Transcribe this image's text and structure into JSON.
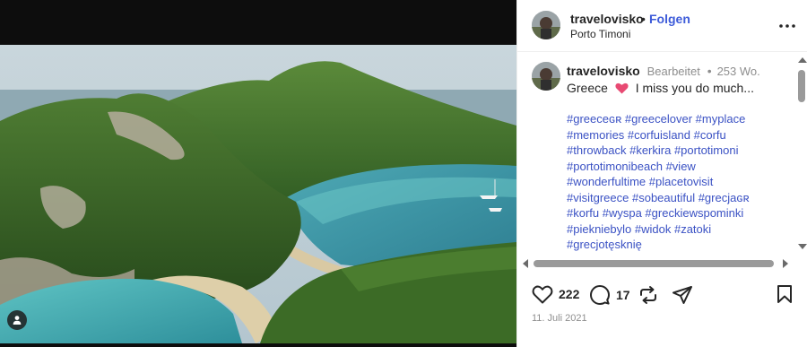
{
  "header": {
    "username": "travelovisko",
    "separator": "•",
    "follow_label": "Folgen",
    "location": "Porto Timoni",
    "more_icon": "more-horizontal-icon"
  },
  "caption": {
    "username": "travelovisko",
    "edited_label": "Bearbeitet",
    "separator": "•",
    "age": "253 Wo.",
    "text_before": "Greece",
    "text_after": "I miss you do much...",
    "emoji": "heart-emoji",
    "hashtag_lines": [
      "#greeceɢʀ #greecelover #myplace",
      "#memories #corfuisland #corfu",
      "#throwback #kerkira #portotimoni",
      "#portotimonibeach #view",
      "#wonderfultime #placetovisit",
      "#visitgreece #sobeautiful #grecjaɢʀ",
      "#korfu #wyspa #greckiewspominki",
      "#piekniebylo #widok #zatoki",
      "#grecjotęsknię"
    ]
  },
  "actions": {
    "like_count": "222",
    "comment_count": "17"
  },
  "date": "11. Juli 2021",
  "colors": {
    "link": "#3d5bd9",
    "heart": "#ed4956",
    "muted": "#8e8e8e"
  }
}
